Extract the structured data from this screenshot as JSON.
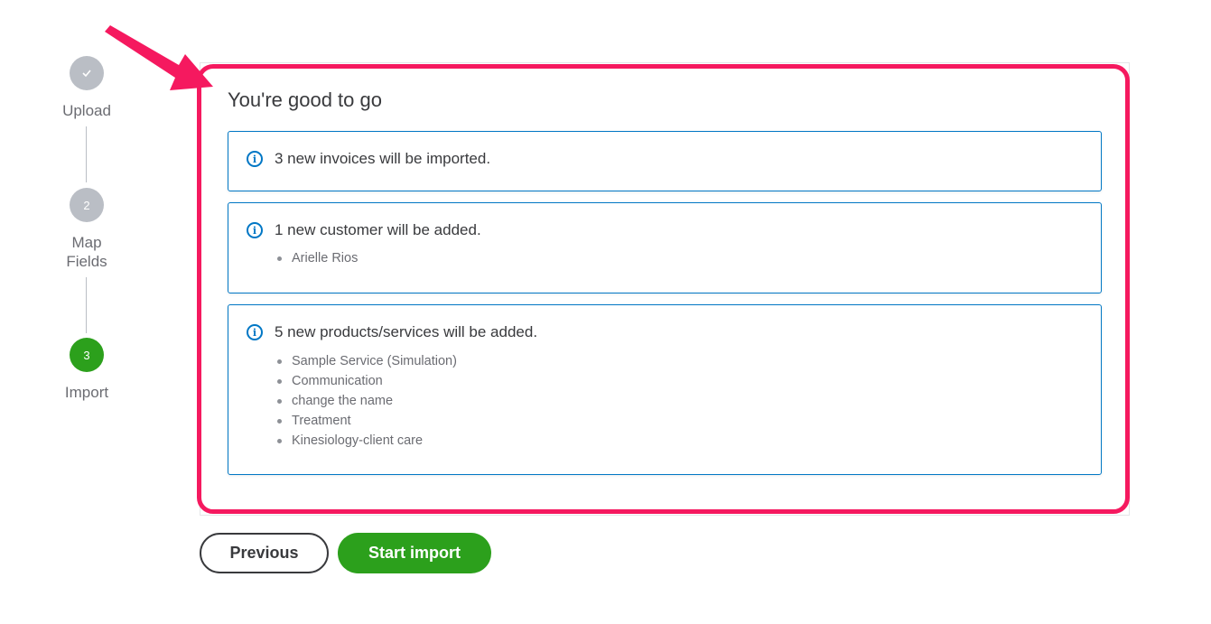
{
  "stepper": {
    "steps": [
      {
        "label": "Upload",
        "marker": "✓",
        "state": "completed"
      },
      {
        "label": "Map\nFields",
        "marker": "2",
        "state": "pending"
      },
      {
        "label": "Import",
        "marker": "3",
        "state": "active"
      }
    ]
  },
  "card": {
    "title": "You're good to go",
    "messages": [
      {
        "text": "3 new invoices will be imported.",
        "items": []
      },
      {
        "text": "1 new customer will be added.",
        "items": [
          "Arielle Rios"
        ]
      },
      {
        "text": "5 new products/services will be added.",
        "items": [
          "Sample Service (Simulation)",
          "Communication",
          "change the name",
          "Treatment",
          "Kinesiology-client care"
        ]
      }
    ]
  },
  "buttons": {
    "previous": "Previous",
    "start_import": "Start import"
  },
  "colors": {
    "accent_green": "#2ca01c",
    "info_blue": "#0077c5",
    "highlight_pink": "#f5195f",
    "step_gray": "#babec5"
  },
  "icons": {
    "info": "info-icon",
    "check": "check-icon",
    "annotation_arrow": "arrow-icon"
  }
}
